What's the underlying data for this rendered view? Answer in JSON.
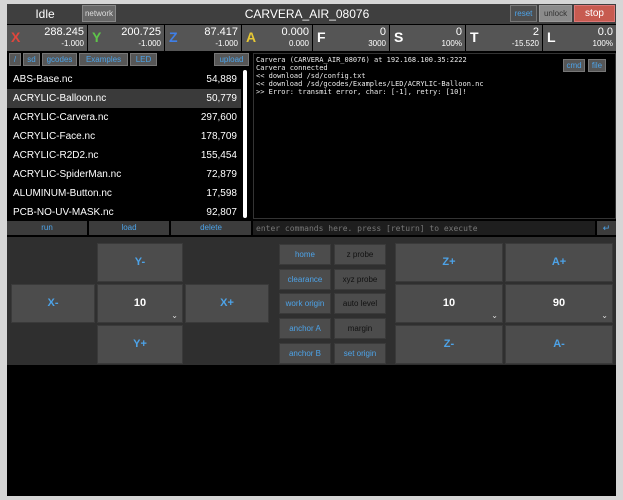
{
  "topbar": {
    "state": "Idle",
    "network_label": "network",
    "machine_name": "CARVERA_AIR_08076",
    "reset_label": "reset",
    "unlock_label": "unlock",
    "stop_label": "stop"
  },
  "coords": [
    {
      "axis": "X",
      "value": "288.245",
      "sub": "-1.000",
      "color": "#e0463c"
    },
    {
      "axis": "Y",
      "value": "200.725",
      "sub": "-1.000",
      "color": "#5ec54a"
    },
    {
      "axis": "Z",
      "value": "87.417",
      "sub": "-1.000",
      "color": "#3f7fe8"
    },
    {
      "axis": "A",
      "value": "0.000",
      "sub": "0.000",
      "color": "#e6c835"
    },
    {
      "axis": "F",
      "value": "0",
      "sub": "3000",
      "color": "#ffffff"
    },
    {
      "axis": "S",
      "value": "0",
      "sub": "100%",
      "color": "#ffffff"
    },
    {
      "axis": "T",
      "value": "2",
      "sub": "-15.520",
      "color": "#ffffff"
    },
    {
      "axis": "L",
      "value": "0.0",
      "sub": "100%",
      "color": "#ffffff"
    }
  ],
  "file_toolbar": {
    "root": "/",
    "sd": "sd",
    "gcodes": "gcodes",
    "examples": "Examples",
    "led": "LED",
    "upload": "upload"
  },
  "files": [
    {
      "name": "ABS-Base.nc",
      "size": "54,889"
    },
    {
      "name": "ACRYLIC-Balloon.nc",
      "size": "50,779",
      "selected": true
    },
    {
      "name": "ACRYLIC-Carvera.nc",
      "size": "297,600"
    },
    {
      "name": "ACRYLIC-Face.nc",
      "size": "178,709"
    },
    {
      "name": "ACRYLIC-R2D2.nc",
      "size": "155,454"
    },
    {
      "name": "ACRYLIC-SpiderMan.nc",
      "size": "72,879"
    },
    {
      "name": "ALUMINUM-Button.nc",
      "size": "17,598"
    },
    {
      "name": "PCB-NO-UV-MASK.nc",
      "size": "92,807"
    }
  ],
  "file_actions": {
    "run": "run",
    "load": "load",
    "delete": "delete"
  },
  "console": {
    "lines": [
      "Carvera (CARVERA_AIR_08076) at 192.168.100.35:2222",
      "Carvera connected",
      "<< download /sd/config.txt",
      "<< download /sd/gcodes/Examples/LED/ACRYLIC-Balloon.nc",
      ">> Error: transmit error, char: [-1], retry: [10]!"
    ],
    "cmd_label": "cmd",
    "file_label": "file",
    "input_placeholder": "enter commands here. press [return] to execute",
    "enter_icon": "↵"
  },
  "jog": {
    "y_minus": "Y-",
    "y_plus": "Y+",
    "x_minus": "X-",
    "x_plus": "X+",
    "xy_step": "10",
    "z_plus": "Z+",
    "z_minus": "Z-",
    "z_step": "10",
    "a_plus": "A+",
    "a_minus": "A-",
    "a_step": "90",
    "chevron": "⌄"
  },
  "macros": {
    "home": "home",
    "z_probe": "z probe",
    "clearance": "clearance",
    "xyz_probe": "xyz probe",
    "work_origin": "work origin",
    "auto_level": "auto level",
    "anchor_a": "anchor A",
    "margin": "margin",
    "anchor_b": "anchor B",
    "set_origin": "set origin"
  }
}
